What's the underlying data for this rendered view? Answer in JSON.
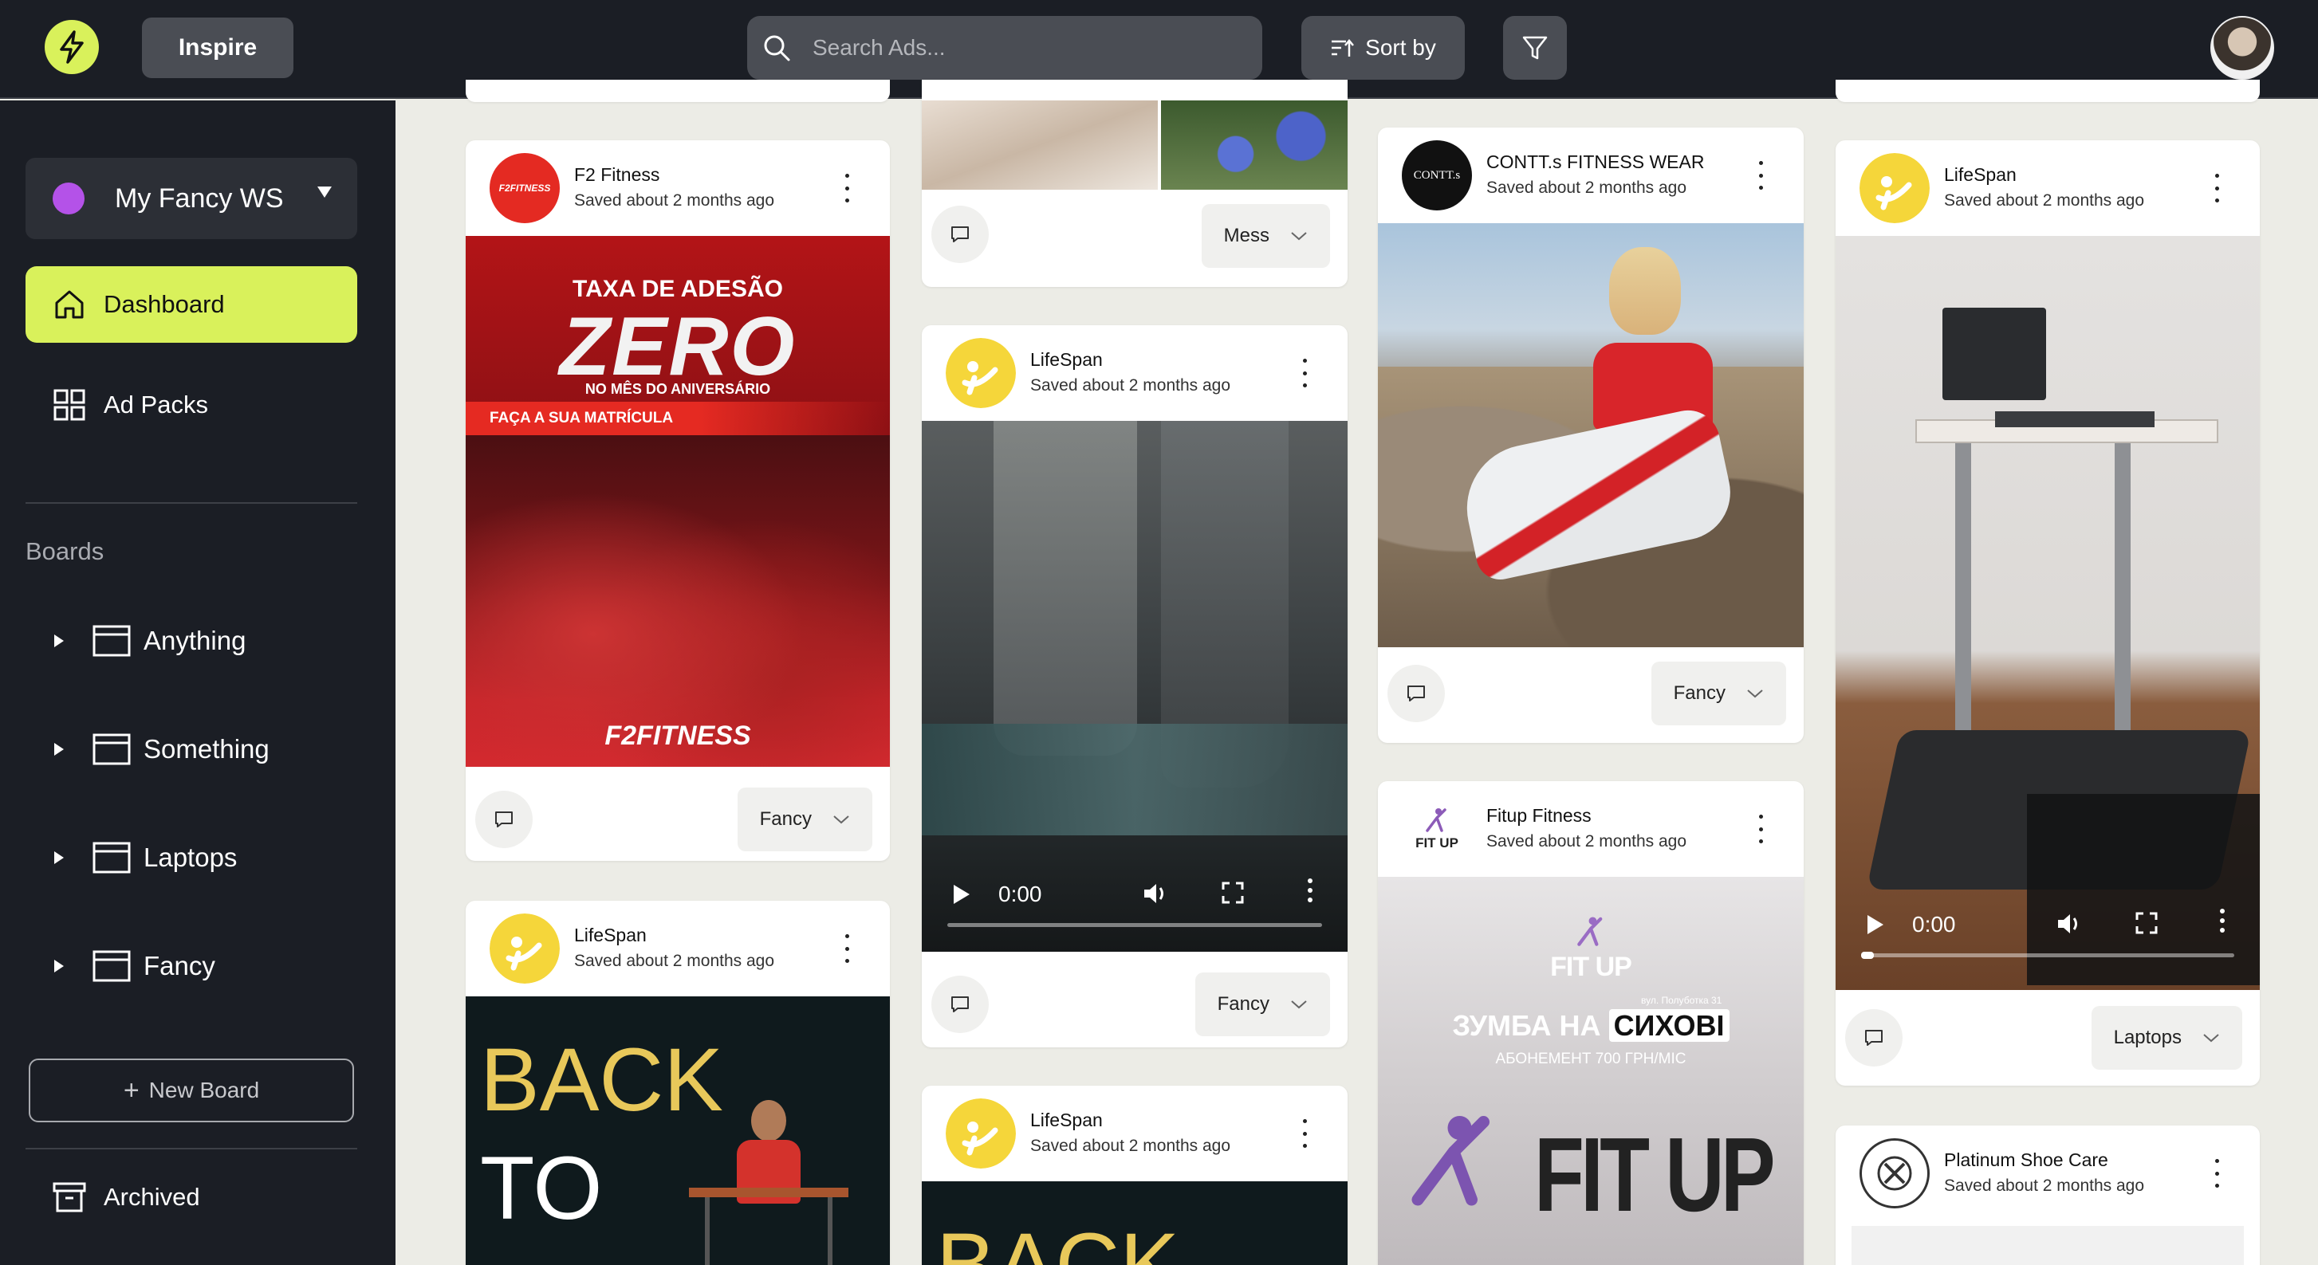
{
  "header": {
    "inspire_label": "Inspire",
    "search_placeholder": "Search Ads...",
    "sort_label": "Sort by"
  },
  "sidebar": {
    "workspace": "My Fancy WS",
    "nav": [
      {
        "label": "Dashboard",
        "active": true
      },
      {
        "label": "Ad Packs",
        "active": false
      }
    ],
    "boards_title": "Boards",
    "boards": [
      {
        "label": "Anything"
      },
      {
        "label": "Something"
      },
      {
        "label": "Laptops"
      },
      {
        "label": "Fancy"
      }
    ],
    "new_board_label": "New Board",
    "archived_label": "Archived"
  },
  "colors": {
    "accent": "#d9f15b",
    "workspace_dot": "#b452e8",
    "dark": "#1b1e25"
  },
  "cards": {
    "f2": {
      "brand": "F2 Fitness",
      "saved": "Saved about 2 months ago",
      "logo_text": "F2FITNESS",
      "ad_line1": "TAXA DE ADESÃO",
      "ad_big": "ZERO",
      "ad_line2": "NO MÊS DO ANIVERSÁRIO",
      "ad_banner": "FAÇA A SUA MATRÍCULA",
      "ad_footer": "F2FITNESS",
      "board": "Fancy"
    },
    "lifespan_back": {
      "brand": "LifeSpan",
      "saved": "Saved about 2 months ago",
      "ad_line1": "BACK",
      "ad_line2": "TO"
    },
    "top_partial": {
      "board": "Mess"
    },
    "lifespan_video1": {
      "brand": "LifeSpan",
      "saved": "Saved about 2 months ago",
      "time": "0:00",
      "board": "Fancy"
    },
    "lifespan_back2": {
      "brand": "LifeSpan",
      "saved": "Saved about 2 months ago",
      "ad_line1": "BACK"
    },
    "contt": {
      "brand": "CONTT.s FITNESS WEAR",
      "saved": "Saved about 2 months ago",
      "logo_text": "CONTT.s",
      "board": "Fancy"
    },
    "fitup": {
      "brand": "Fitup Fitness",
      "saved": "Saved about 2 months ago",
      "logo_text": "FIT UP",
      "ad_logo": "FIT UP",
      "ad_address": "вул. Полуботка 31",
      "ad_title_a": "ЗУМБА НА",
      "ad_title_b": "СИХОВІ",
      "ad_sub": "АБОНЕМЕНТ 700 ГРН/МІС",
      "ad_big": "FIT UP"
    },
    "lifespan_video2": {
      "brand": "LifeSpan",
      "saved": "Saved about 2 months ago",
      "time": "0:00",
      "board": "Laptops"
    },
    "platinum": {
      "brand": "Platinum Shoe Care",
      "saved": "Saved about 2 months ago"
    }
  }
}
